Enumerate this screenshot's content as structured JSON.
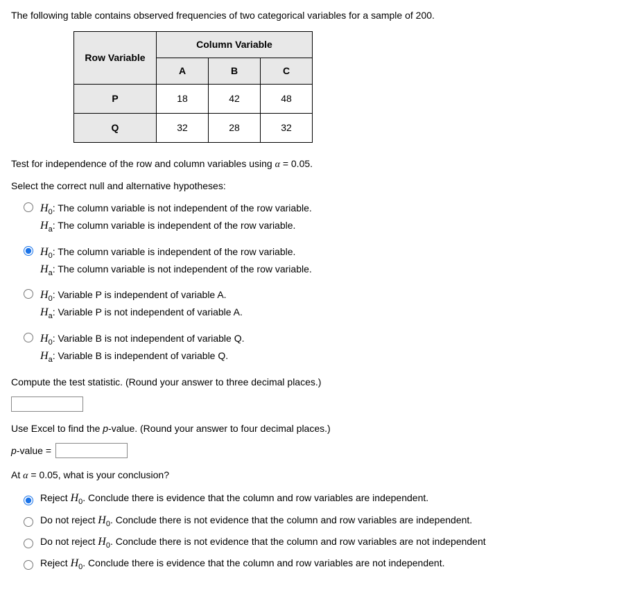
{
  "intro": "The following table contains observed frequencies of two categorical variables for a sample of 200.",
  "table": {
    "row_header": "Row Variable",
    "col_header": "Column Variable",
    "cols": [
      "A",
      "B",
      "C"
    ],
    "rows": [
      {
        "label": "P",
        "vals": [
          "18",
          "42",
          "48"
        ]
      },
      {
        "label": "Q",
        "vals": [
          "32",
          "28",
          "32"
        ]
      }
    ]
  },
  "test_line": {
    "pre": "Test for independence of the row and column variables using ",
    "alpha": "α",
    "eq": " = 0.05."
  },
  "select_line": "Select the correct null and alternative hypotheses:",
  "hyp_options": [
    {
      "selected": false,
      "h0": "The column variable is not independent of the row variable.",
      "ha": "The column variable is independent of the row variable."
    },
    {
      "selected": true,
      "h0": "The column variable is independent of the row variable.",
      "ha": "The column variable is not independent of the row variable."
    },
    {
      "selected": false,
      "h0": "Variable P is independent of variable A.",
      "ha": "Variable P is not independent of variable A."
    },
    {
      "selected": false,
      "h0": "Variable B is not independent of variable Q.",
      "ha": "Variable B is independent of variable Q."
    }
  ],
  "compute_line": "Compute the test statistic. (Round your answer to three decimal places.)",
  "test_stat_value": "",
  "excel_line": {
    "pre": "Use Excel to find the ",
    "p": "p",
    "post": "-value. (Round your answer to four decimal places.)"
  },
  "pvalue_label": {
    "p": "p",
    "rest": "-value = "
  },
  "pvalue_value": "",
  "conclusion_q": {
    "pre": "At ",
    "alpha": "α",
    "post": " = 0.05, what is your conclusion?"
  },
  "concl_options": [
    {
      "selected": true,
      "pre": "Reject ",
      "post": ". Conclude there is evidence that the column and row variables are independent."
    },
    {
      "selected": false,
      "pre": "Do not reject ",
      "post": ". Conclude there is not evidence that the column and row variables are independent."
    },
    {
      "selected": false,
      "pre": "Do not reject ",
      "post": ". Conclude there is not evidence that the column and row variables are not independent"
    },
    {
      "selected": false,
      "pre": "Reject ",
      "post": ". Conclude there is evidence that the column and row variables are not independent."
    }
  ],
  "sym": {
    "H": "H",
    "zero": "0",
    "a": "a"
  }
}
